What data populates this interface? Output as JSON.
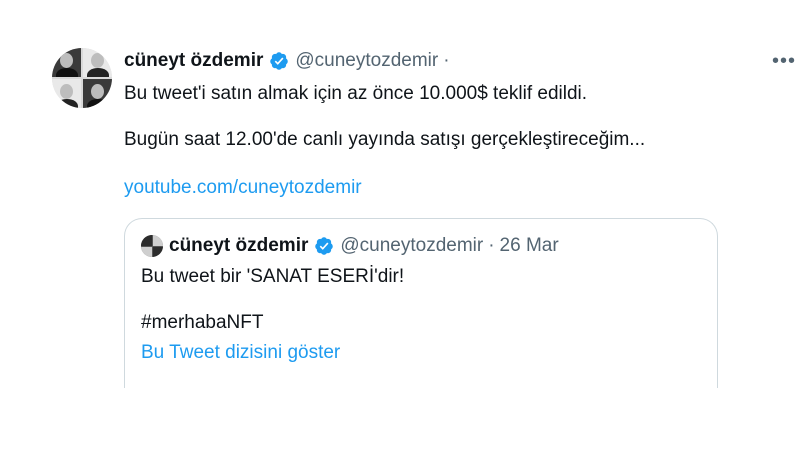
{
  "tweet": {
    "author_name": "cüneyt özdemir",
    "author_handle": "@cuneytozdemir",
    "separator": "·",
    "more_label": "•••",
    "line1": "Bu tweet'i satın almak için az önce 10.000$ teklif edildi.",
    "line2": "Bugün saat 12.00'de canlı yayında satışı gerçekleştireceğim...",
    "link": "youtube.com/cuneytozdemir"
  },
  "quote": {
    "author_name": "cüneyt özdemir",
    "author_handle": "@cuneytozdemir",
    "separator": "·",
    "date": "26 Mar",
    "text": "Bu tweet bir 'SANAT ESERİ'dir!",
    "hashtag": "#merhabaNFT",
    "show_thread": "Bu Tweet dizisini göster"
  },
  "colors": {
    "link": "#1d9bf0",
    "verified": "#1d9bf0",
    "secondary_text": "#536471",
    "border": "#cfd9de"
  },
  "icons": {
    "verified": "verified-badge-icon",
    "more": "more-horizontal-icon"
  }
}
